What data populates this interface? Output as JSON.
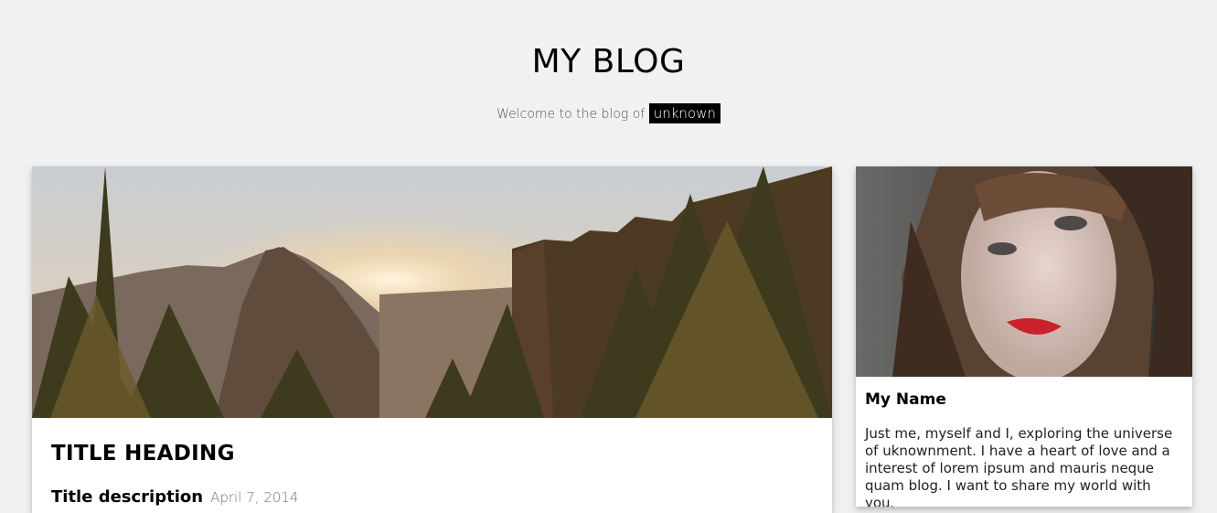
{
  "header": {
    "title": "MY BLOG",
    "welcome_text": "Welcome to the blog of",
    "username": "unknown"
  },
  "post": {
    "title": "TITLE HEADING",
    "description": "Title description",
    "date": "April 7, 2014",
    "image": "mountain-sunset-photo"
  },
  "profile": {
    "name": "My Name",
    "bio": "Just me, myself and I, exploring the universe of uknownment. I have a heart of love and a interest of lorem ipsum and mauris neque quam blog. I want to share my world with you.",
    "image": "woman-portrait-photo"
  }
}
